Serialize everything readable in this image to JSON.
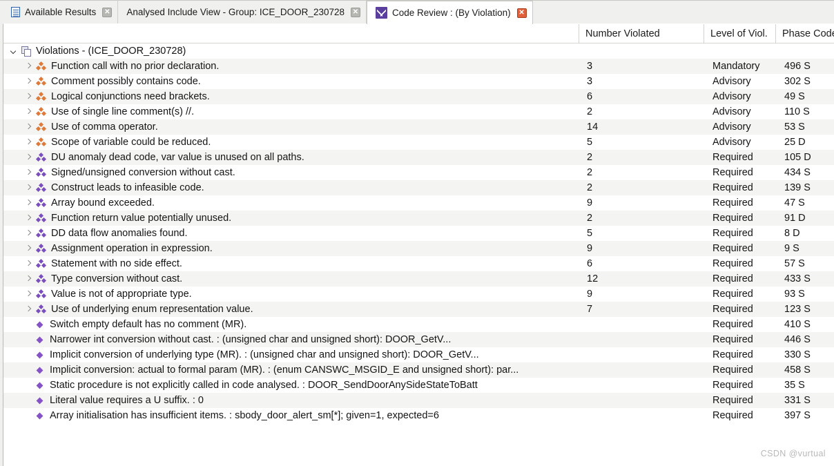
{
  "tabs": [
    {
      "label": "Available Results",
      "icon": "document-icon",
      "active": false,
      "closable": true,
      "close_style": "grey"
    },
    {
      "label": "Analysed Include View - Group: ICE_DOOR_230728",
      "icon": "none",
      "active": false,
      "closable": true,
      "close_style": "grey"
    },
    {
      "label": "Code Review : (By Violation)",
      "icon": "code-review-icon",
      "active": true,
      "closable": true,
      "close_style": "accent"
    }
  ],
  "colors": {
    "advisory_icon": "#e07a3a",
    "required_icon": "#7b4ec0",
    "leaf_icon": "#8552c8",
    "active_tab_accent": "#5b3f9e",
    "close_accent": "#e0603a"
  },
  "table": {
    "columns": [
      {
        "key": "name",
        "label": ""
      },
      {
        "key": "number",
        "label": "Number Violated"
      },
      {
        "key": "level",
        "label": "Level of Viol."
      },
      {
        "key": "phase",
        "label": "Phase Code"
      }
    ],
    "root": {
      "label": "Violations - (ICE_DOOR_230728)",
      "expanded": true,
      "icon": "group-icon",
      "number": "",
      "level": "",
      "phase": ""
    },
    "rows": [
      {
        "name": "Function call with no prior declaration.",
        "number": "3",
        "level": "Mandatory",
        "phase": "496 S",
        "depth": 1,
        "twisty": "right",
        "icon": "cluster-orange"
      },
      {
        "name": "Comment possibly contains code.",
        "number": "3",
        "level": "Advisory",
        "phase": "302 S",
        "depth": 1,
        "twisty": "right",
        "icon": "cluster-orange"
      },
      {
        "name": "Logical conjunctions need brackets.",
        "number": "6",
        "level": "Advisory",
        "phase": "49 S",
        "depth": 1,
        "twisty": "right",
        "icon": "cluster-orange"
      },
      {
        "name": "Use of single line comment(s) //.",
        "number": "2",
        "level": "Advisory",
        "phase": "110 S",
        "depth": 1,
        "twisty": "right",
        "icon": "cluster-orange"
      },
      {
        "name": "Use of comma operator.",
        "number": "14",
        "level": "Advisory",
        "phase": "53 S",
        "depth": 1,
        "twisty": "right",
        "icon": "cluster-orange"
      },
      {
        "name": "Scope of variable could be reduced.",
        "number": "5",
        "level": "Advisory",
        "phase": "25 D",
        "depth": 1,
        "twisty": "right",
        "icon": "cluster-orange"
      },
      {
        "name": "DU anomaly dead code, var value is unused on all paths.",
        "number": "2",
        "level": "Required",
        "phase": "105 D",
        "depth": 1,
        "twisty": "right",
        "icon": "cluster-purple"
      },
      {
        "name": "Signed/unsigned conversion without cast.",
        "number": "2",
        "level": "Required",
        "phase": "434 S",
        "depth": 1,
        "twisty": "right",
        "icon": "cluster-purple"
      },
      {
        "name": "Construct leads to infeasible code.",
        "number": "2",
        "level": "Required",
        "phase": "139 S",
        "depth": 1,
        "twisty": "right",
        "icon": "cluster-purple"
      },
      {
        "name": "Array bound exceeded.",
        "number": "9",
        "level": "Required",
        "phase": "47 S",
        "depth": 1,
        "twisty": "right",
        "icon": "cluster-purple"
      },
      {
        "name": "Function return value potentially unused.",
        "number": "2",
        "level": "Required",
        "phase": "91 D",
        "depth": 1,
        "twisty": "right",
        "icon": "cluster-purple"
      },
      {
        "name": "DD data flow anomalies found.",
        "number": "5",
        "level": "Required",
        "phase": "8 D",
        "depth": 1,
        "twisty": "right",
        "icon": "cluster-purple"
      },
      {
        "name": "Assignment operation in expression.",
        "number": "9",
        "level": "Required",
        "phase": "9 S",
        "depth": 1,
        "twisty": "right",
        "icon": "cluster-purple"
      },
      {
        "name": "Statement with no side effect.",
        "number": "6",
        "level": "Required",
        "phase": "57 S",
        "depth": 1,
        "twisty": "right",
        "icon": "cluster-purple"
      },
      {
        "name": "Type conversion without cast.",
        "number": "12",
        "level": "Required",
        "phase": "433 S",
        "depth": 1,
        "twisty": "right",
        "icon": "cluster-purple"
      },
      {
        "name": "Value is not of appropriate type.",
        "number": "9",
        "level": "Required",
        "phase": "93 S",
        "depth": 1,
        "twisty": "right",
        "icon": "cluster-purple"
      },
      {
        "name": "Use of underlying enum representation value.",
        "number": "7",
        "level": "Required",
        "phase": "123 S",
        "depth": 1,
        "twisty": "right",
        "icon": "cluster-purple"
      },
      {
        "name": "Switch empty default has no comment (MR).",
        "number": "",
        "level": "Required",
        "phase": "410 S",
        "depth": 1,
        "twisty": "none",
        "icon": "diamond"
      },
      {
        "name": "Narrower int conversion without cast. : (unsigned char and unsigned short): DOOR_GetV...",
        "number": "",
        "level": "Required",
        "phase": "446 S",
        "depth": 1,
        "twisty": "none",
        "icon": "diamond"
      },
      {
        "name": "Implicit conversion of underlying type (MR). : (unsigned char and unsigned short): DOOR_GetV...",
        "number": "",
        "level": "Required",
        "phase": "330 S",
        "depth": 1,
        "twisty": "none",
        "icon": "diamond"
      },
      {
        "name": "Implicit conversion: actual to formal param (MR). : (enum CANSWC_MSGID_E and unsigned short): par...",
        "number": "",
        "level": "Required",
        "phase": "458 S",
        "depth": 1,
        "twisty": "none",
        "icon": "diamond"
      },
      {
        "name": "Static procedure is not explicitly called in code analysed. : DOOR_SendDoorAnySideStateToBatt",
        "number": "",
        "level": "Required",
        "phase": "35 S",
        "depth": 1,
        "twisty": "none",
        "icon": "diamond"
      },
      {
        "name": "Literal value requires a U suffix. : 0",
        "number": "",
        "level": "Required",
        "phase": "331 S",
        "depth": 1,
        "twisty": "none",
        "icon": "diamond"
      },
      {
        "name": "Array initialisation has insufficient items. : sbody_door_alert_sm[*]; given=1, expected=6",
        "number": "",
        "level": "Required",
        "phase": "397 S",
        "depth": 1,
        "twisty": "none",
        "icon": "diamond"
      }
    ]
  },
  "watermark": "CSDN @vurtual"
}
